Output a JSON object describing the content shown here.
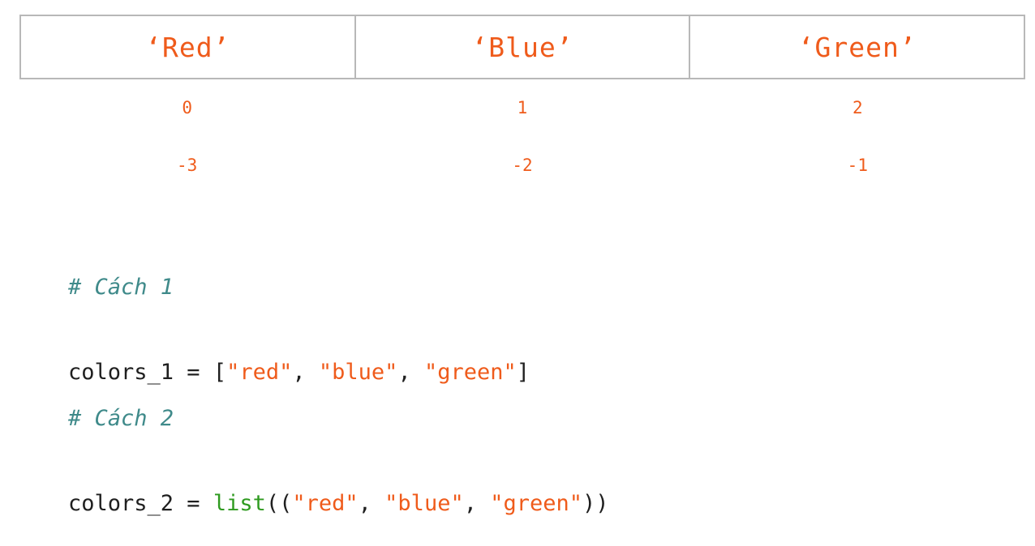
{
  "list_items": [
    "‘Red’",
    "‘Blue’",
    "‘Green’"
  ],
  "positive_indices": [
    "0",
    "1",
    "2"
  ],
  "negative_indices": [
    "-3",
    "-2",
    "-1"
  ],
  "code_block_1": {
    "comment": "# Cách 1",
    "var": "colors_1",
    "op": " = ",
    "open": "[",
    "s1": "\"red\"",
    "sep1": ", ",
    "s2": "\"blue\"",
    "sep2": ", ",
    "s3": "\"green\"",
    "close": "]"
  },
  "code_block_2": {
    "comment": "# Cách 2",
    "var": "colors_2",
    "op": " = ",
    "func": "list",
    "open": "((",
    "s1": "\"red\"",
    "sep1": ", ",
    "s2": "\"blue\"",
    "sep2": ", ",
    "s3": "\"green\"",
    "close": "))"
  },
  "colors": {
    "accent_orange": "#ef5b1b",
    "comment_teal": "#3f8a8a",
    "builtin_green": "#2e9a1f",
    "border_gray": "#b8b8b8"
  }
}
